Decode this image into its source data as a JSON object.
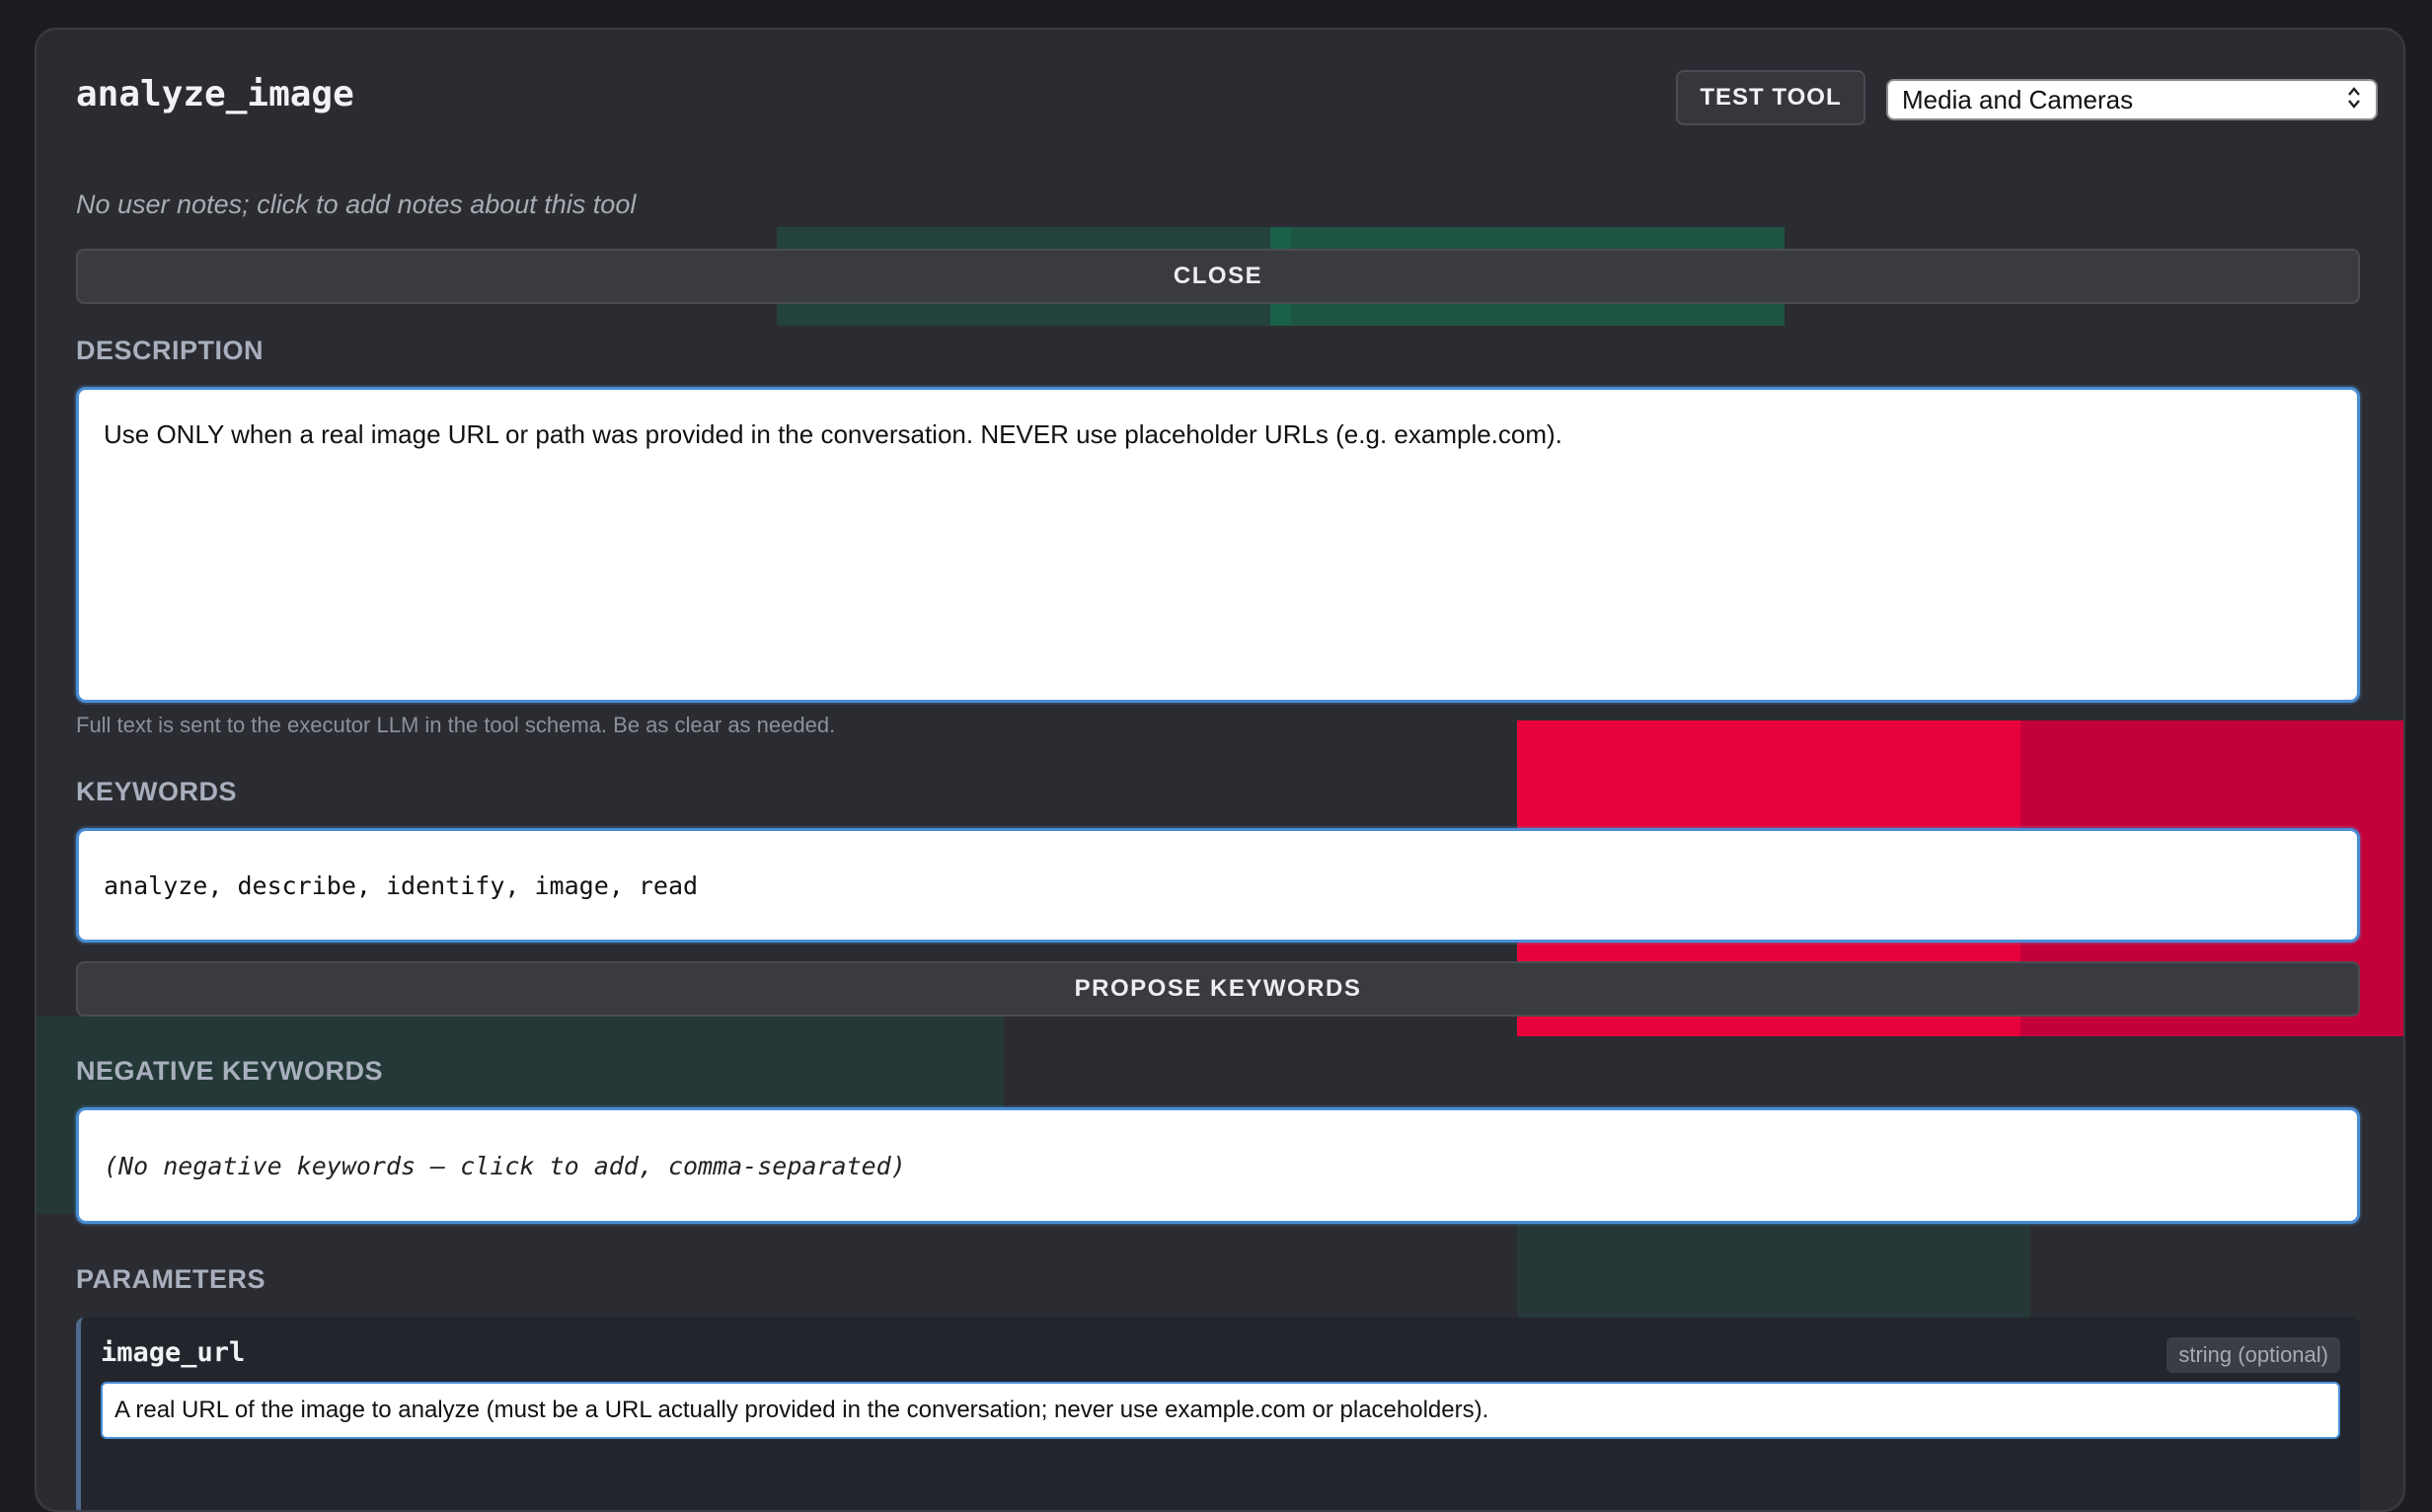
{
  "tool": {
    "name": "analyze_image",
    "notes_placeholder": "No user notes; click to add notes about this tool"
  },
  "header": {
    "test_tool_label": "TEST TOOL",
    "category_select": {
      "selected": "Media and Cameras",
      "icon": "chevron-updown-icon"
    }
  },
  "close_label": "CLOSE",
  "description": {
    "label": "DESCRIPTION",
    "text": "Use ONLY when a real image URL or path was provided in the conversation. NEVER use placeholder URLs (e.g. example.com).",
    "hint": "Full text is sent to the executor LLM in the tool schema. Be as clear as needed."
  },
  "keywords": {
    "label": "KEYWORDS",
    "value": "analyze, describe, identify, image, read",
    "propose_label": "PROPOSE KEYWORDS"
  },
  "negative_keywords": {
    "label": "NEGATIVE KEYWORDS",
    "placeholder": "(No negative keywords — click to add, comma-separated)"
  },
  "parameters": {
    "label": "PARAMETERS",
    "items": [
      {
        "name": "image_url",
        "type": "string (optional)",
        "description": "A real URL of the image to analyze (must be a URL actually provided in the conversation; never use example.com or placeholders)."
      }
    ]
  },
  "colors": {
    "page_bg": "#1c1d22",
    "panel_bg": "#2b2c32",
    "focus_border": "#4a8fd6",
    "label_text": "#a8afbd"
  }
}
